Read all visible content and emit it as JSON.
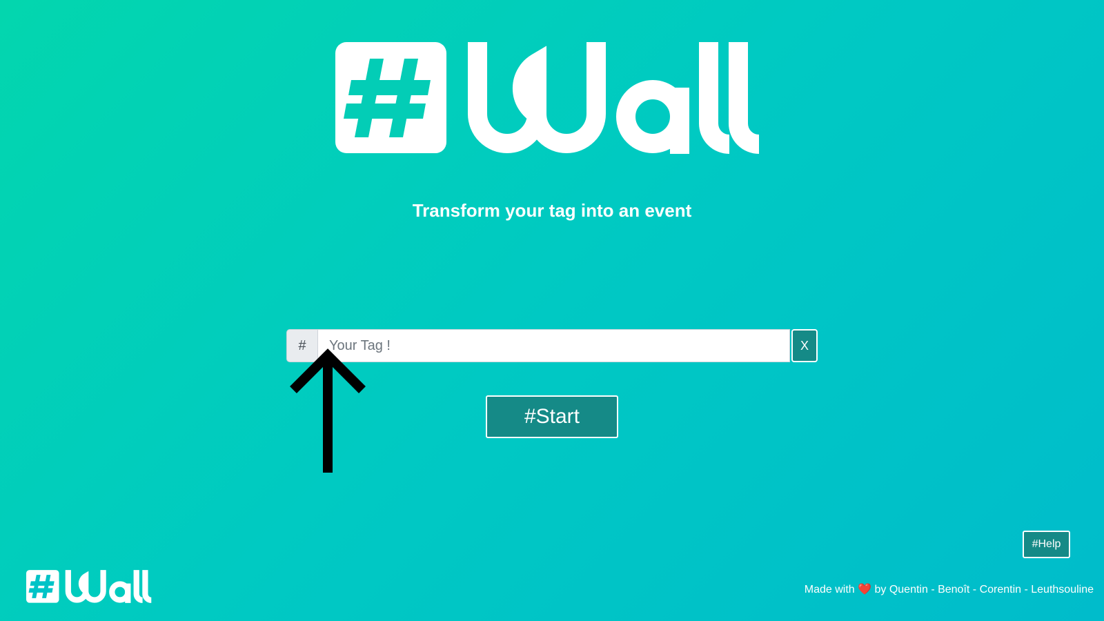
{
  "header": {
    "logo_alt": "#Wall"
  },
  "tagline": "Transform your tag into an event",
  "search": {
    "prefix": "#",
    "placeholder": "Your Tag !",
    "value": "",
    "clear_label": "X"
  },
  "annotation": {
    "icon": "arrow-up-icon"
  },
  "start_button_label": "#Start",
  "help_button_label": "#Help",
  "footer": {
    "logo_alt": "#Wall",
    "made_with": "Made with",
    "heart_icon": "heart-icon",
    "heart": "❤️",
    "credits": "by Quentin - Benoît - Corentin - Leuthsouline"
  },
  "colors": {
    "background_start": "#03d6ae",
    "background_end": "#00bccb",
    "button": "#158a87",
    "heart": "#d7141a"
  }
}
